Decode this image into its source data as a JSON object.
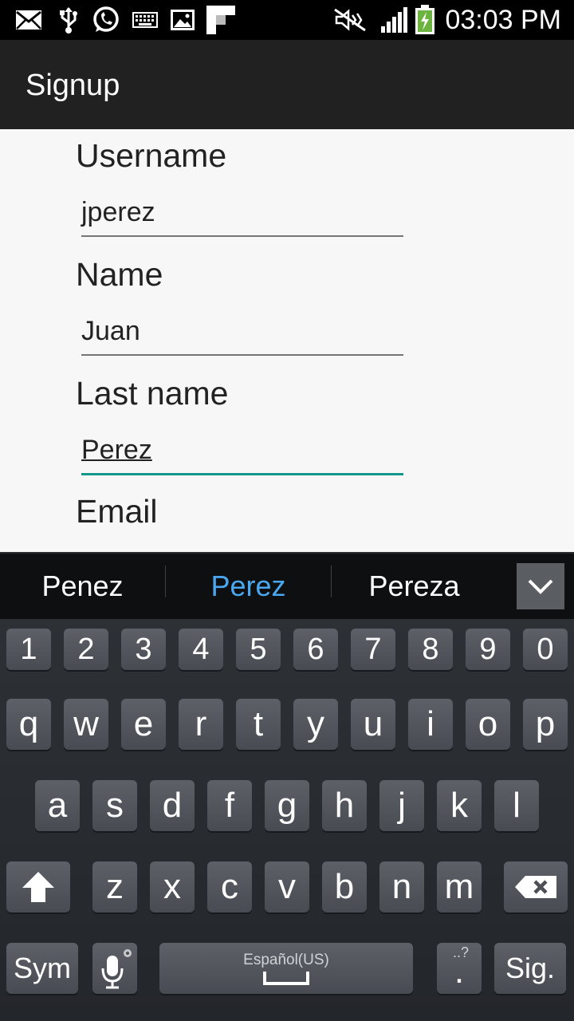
{
  "status_bar": {
    "time": "03:03 PM",
    "icons": [
      "mail-icon",
      "usb-icon",
      "whatsapp-icon",
      "keyboard-icon",
      "image-icon",
      "flipboard-icon",
      "no-sound-icon",
      "signal-icon",
      "battery-charging-icon"
    ]
  },
  "app_bar": {
    "title": "Signup"
  },
  "form": {
    "username_label": "Username",
    "username_value": "jperez",
    "name_label": "Name",
    "name_value": "Juan",
    "lastname_label": "Last name",
    "lastname_value": "Perez",
    "email_label": "Email"
  },
  "suggestions": [
    "Penez",
    "Perez",
    "Pereza"
  ],
  "colors": {
    "accent": "#12968a",
    "suggestion_highlight": "#4aa8f0",
    "action_bar": "#212121"
  },
  "keyboard": {
    "number_row": [
      "1",
      "2",
      "3",
      "4",
      "5",
      "6",
      "7",
      "8",
      "9",
      "0"
    ],
    "row1": [
      "q",
      "w",
      "e",
      "r",
      "t",
      "y",
      "u",
      "i",
      "o",
      "p"
    ],
    "row2": [
      "a",
      "s",
      "d",
      "f",
      "g",
      "h",
      "j",
      "k",
      "l"
    ],
    "row3": [
      "z",
      "x",
      "c",
      "v",
      "b",
      "n",
      "m"
    ],
    "sym_label": "Sym",
    "space_label": "Español(US)",
    "period_label": ".",
    "period_hint": "..?",
    "next_label": "Sig."
  }
}
